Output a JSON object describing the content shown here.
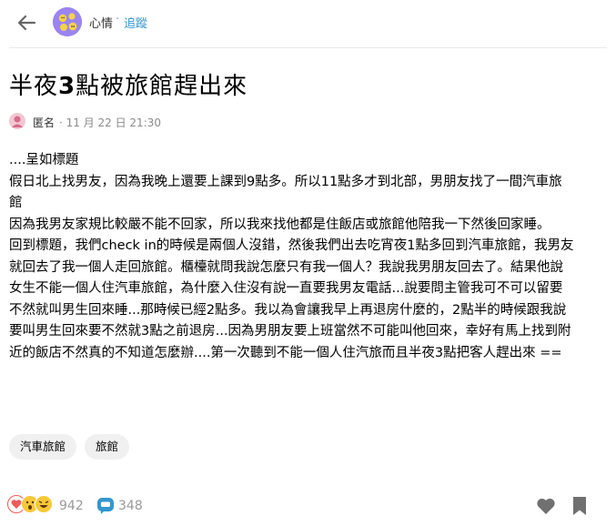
{
  "header": {
    "board_name": "心情",
    "separator": "·",
    "follow_label": "追蹤"
  },
  "post": {
    "title_part1": "半夜",
    "title_bold": "3",
    "title_part2": "點被旅館趕出來",
    "author": "匿名",
    "meta": "· 11 月 22 日 21:30",
    "content": [
      "....呈如標題",
      "假日北上找男友，因為我晚上還要上課到9點多。所以11點多才到北部，男朋友找了一間汽車旅",
      "館",
      "因為我男友家規比較嚴不能不回家，所以我來找他都是住飯店或旅館他陪我一下然後回家睡。",
      "回到標題，我們check in的時候是兩個人沒錯，然後我們出去吃宵夜1點多回到汽車旅館，我男友",
      "就回去了我一個人走回旅館。櫃檯就問我說怎麼只有我一個人？我說我男朋友回去了。結果他說",
      "女生不能一個人住汽車旅館，為什麼入住沒有說一直要我男友電話...說要問主管我可不可以留要",
      "不然就叫男生回來睡...那時候已經2點多。我以為會讓我早上再退房什麼的，2點半的時候跟我說",
      "要叫男生回來要不然就3點之前退房...因為男朋友要上班當然不可能叫他回來，幸好有馬上找到附",
      "近的飯店不然真的不知道怎麼辦....第一次聽到不能一個人住汽旅而且半夜3點把客人趕出來 =="
    ],
    "tags": [
      "汽車旅館",
      "旅館"
    ]
  },
  "footer": {
    "reaction_count": "942",
    "comment_count": "348"
  },
  "colors": {
    "accent": "#3397cf",
    "muted": "#999999",
    "tag_bg": "#f0f0f0",
    "icon_gray": "#666666",
    "board_avatar": "#9b84f0",
    "comment_blue": "#3397cf"
  },
  "icons": [
    "back-arrow-icon",
    "board-avatar",
    "author-avatar",
    "heart-reaction-icon",
    "wow-reaction-icon",
    "haha-reaction-icon",
    "comment-icon",
    "heart-outline-icon",
    "bookmark-icon"
  ]
}
